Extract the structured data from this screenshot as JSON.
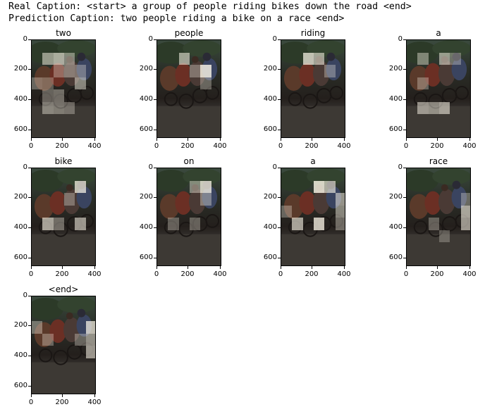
{
  "captions": {
    "real": "Real Caption: <start> a group of people riding bikes down the road <end>",
    "prediction": "Prediction Caption: two people riding a bike on a race <end>"
  },
  "axes": {
    "y_ticks": [
      "0",
      "200",
      "400",
      "600"
    ],
    "x_ticks": [
      "0",
      "200",
      "400"
    ]
  },
  "panels": [
    {
      "word": "two"
    },
    {
      "word": "people"
    },
    {
      "word": "riding"
    },
    {
      "word": "a"
    },
    {
      "word": "bike"
    },
    {
      "word": "on"
    },
    {
      "word": "a"
    },
    {
      "word": "race"
    },
    {
      "word": "<end>"
    }
  ]
}
